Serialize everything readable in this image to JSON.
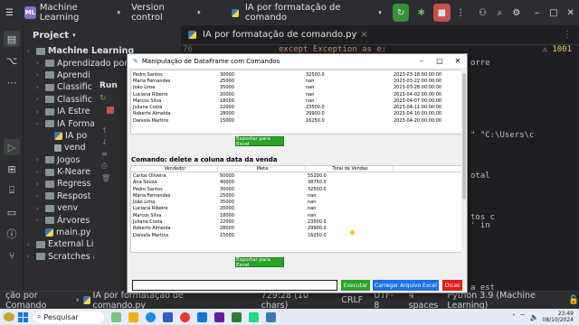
{
  "titlebar": {
    "project_badge": "ML",
    "project_name": "Machine Learning",
    "vcs": "Version control",
    "run_config": "IA por formatação de comando"
  },
  "project_panel": {
    "header": "Project",
    "items": [
      {
        "label": "Machine Learning",
        "kind": "folder",
        "indent": 0,
        "bold": true
      },
      {
        "label": "Aprendizado por R",
        "kind": "folder",
        "indent": 1
      },
      {
        "label": "Aprendi",
        "kind": "folder",
        "indent": 1
      },
      {
        "label": "Classific",
        "kind": "folder",
        "indent": 1
      },
      {
        "label": "Classific",
        "kind": "folder",
        "indent": 1
      },
      {
        "label": "IA Estre",
        "kind": "folder",
        "indent": 1
      },
      {
        "label": "IA Forma",
        "kind": "folder",
        "indent": 1
      },
      {
        "label": "IA po",
        "kind": "py",
        "indent": 2
      },
      {
        "label": "vend",
        "kind": "file",
        "indent": 2
      },
      {
        "label": "Jogos",
        "kind": "folder",
        "indent": 1
      },
      {
        "label": "K-Neare",
        "kind": "folder",
        "indent": 1
      },
      {
        "label": "Regress",
        "kind": "folder",
        "indent": 1
      },
      {
        "label": "Respost",
        "kind": "folder",
        "indent": 1
      },
      {
        "label": "venv",
        "kind": "folder",
        "indent": 1
      },
      {
        "label": "Árvores",
        "kind": "folder",
        "indent": 1
      },
      {
        "label": "main.py",
        "kind": "py",
        "indent": 1
      },
      {
        "label": "External Li",
        "kind": "folder",
        "indent": 0
      },
      {
        "label": "Scratches and Conso",
        "kind": "folder",
        "indent": 0
      }
    ],
    "run_label": "Run"
  },
  "editor": {
    "tab": "IA por formatação de comando.py",
    "code_line": "except Exception as e:",
    "line_number": "76",
    "warnings": "1001",
    "snippets": [
      "orre",
      "\" \"C:\\Users\\c",
      "otal",
      "tos c",
      "' in",
      "a est"
    ]
  },
  "dialog": {
    "title": "Manipulação de DataFrame com Comandos",
    "table1": [
      [
        "Pedro Santos",
        "30000",
        "32500.0",
        "2023-03-18 00:00:00"
      ],
      [
        "Maria Fernandes",
        "25000",
        "nan",
        "2023-03-22 00:00:00"
      ],
      [
        "João Lima",
        "35000",
        "nan",
        "2023-03-28 00:00:00"
      ],
      [
        "Luciana Ribeiro",
        "20000",
        "nan",
        "2023-04-02 00:00:00"
      ],
      [
        "Marcos Silva",
        "18000",
        "nan",
        "2023-04-07 00:00:00"
      ],
      [
        "Juliana Costa",
        "22000",
        "23500.0",
        "2023-04-11 00:00:00"
      ],
      [
        "Roberto Almeida",
        "28000",
        "29900.0",
        "2023-04-16 00:00:00"
      ],
      [
        "Daniela Martins",
        "15000",
        "16250.0",
        "2023-04-20 00:00:00"
      ]
    ],
    "export_label": "Exportar para Excel",
    "section_label": "Comando: delete a coluna data da venda",
    "table2_headers": [
      "Vendedor",
      "Meta",
      "Total de Vendas"
    ],
    "table2": [
      [
        "Carlos Oliveira",
        "50000",
        "55200.0"
      ],
      [
        "Ana Souza",
        "40000",
        "38750.0"
      ],
      [
        "Pedro Santos",
        "30000",
        "32500.0"
      ],
      [
        "Maria Fernandes",
        "25000",
        "nan"
      ],
      [
        "João Lima",
        "35000",
        "nan"
      ],
      [
        "Luciana Ribeiro",
        "20000",
        "nan"
      ],
      [
        "Marcos Silva",
        "18000",
        "nan"
      ],
      [
        "Juliana Costa",
        "22000",
        "23500.0"
      ],
      [
        "Roberto Almeida",
        "28000",
        "29900.0"
      ],
      [
        "Daniela Martins",
        "15000",
        "16250.0"
      ]
    ],
    "buttons": {
      "execute": "Executar",
      "load_excel": "Carregar Arquivo Excel",
      "tips": "Dicas"
    }
  },
  "statusbar": {
    "path": "ção por Comando",
    "file": "IA por formatação de comando.py",
    "cursor": "729:28 (10 chars)",
    "line_sep": "CRLF",
    "encoding": "UTF-8",
    "indent": "4 spaces",
    "interpreter": "Python 3.9 (Machine Learning)"
  },
  "taskbar": {
    "search": "Pesquisar",
    "time": "23:49",
    "date": "08/10/2024"
  },
  "colors": {
    "ide_bg": "#1e1f22",
    "panel_bg": "#2b2d30",
    "export_green": "#29a329",
    "blue_button": "#1a73e8",
    "red_button": "#e02020"
  }
}
